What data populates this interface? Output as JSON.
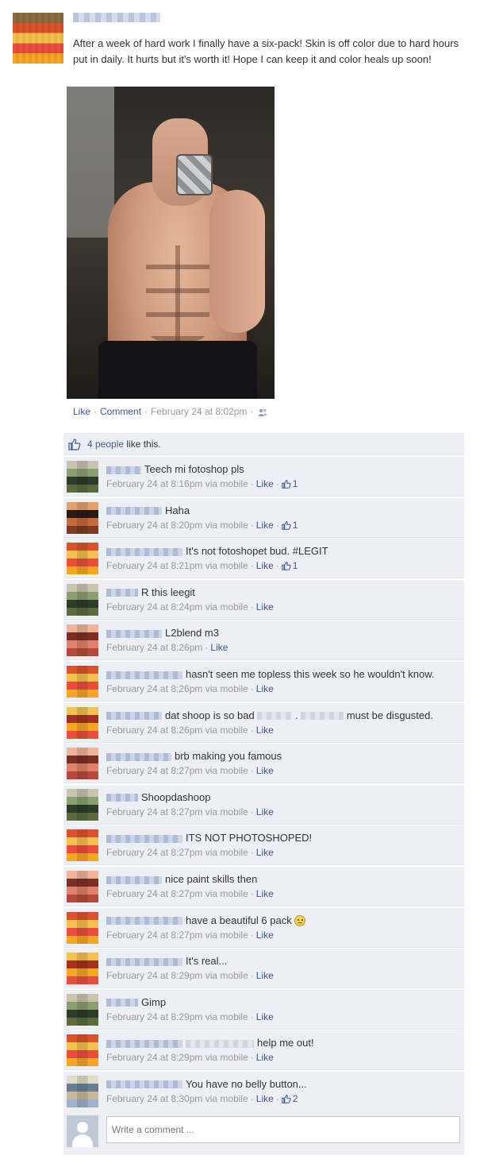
{
  "post": {
    "text": "After a week of hard work I finally have a six-pack! Skin is off color due to hard hours put in daily. It hurts but it's worth it! Hope I can keep it and color heals up soon!",
    "like_label": "Like",
    "comment_label": "Comment",
    "timestamp": "February 24 at 8:02pm",
    "privacy_icon": "friends-icon"
  },
  "likes": {
    "count_text": "4 people",
    "suffix": " like this."
  },
  "comments": [
    {
      "before": "Teech mi fotoshop pls",
      "after": "",
      "time": "February 24 at 8:16pm",
      "via": " via mobile",
      "like": "Like",
      "likes": "1",
      "name_w": 44,
      "pal": [
        "#5a6b3e",
        "#2e3a2a",
        "#8aa070",
        "#c9c3b0"
      ]
    },
    {
      "before": "Haha",
      "after": "",
      "time": "February 24 at 8:20pm",
      "via": " via mobile",
      "like": "Like",
      "likes": "1",
      "name_w": 70,
      "pal": [
        "#7a3b22",
        "#c46a3c",
        "#2a1a14",
        "#e0a070"
      ]
    },
    {
      "before": "It's not fotoshopet bud. #LEGIT",
      "after": "",
      "time": "February 24 at 8:21pm",
      "via": " via mobile",
      "like": "Like",
      "likes": "1",
      "name_w": 96,
      "pal": [
        "#f5a623",
        "#e94e3c",
        "#f2c14e",
        "#d9542b"
      ]
    },
    {
      "before": "R this leegit",
      "after": "",
      "time": "February 24 at 8:24pm",
      "via": " via mobile",
      "like": "Like",
      "likes": "",
      "name_w": 40,
      "pal": [
        "#5a6b3e",
        "#2e3a2a",
        "#8aa070",
        "#c9c3b0"
      ]
    },
    {
      "before": "L2blend m3",
      "after": "",
      "time": "February 24 at 8:26pm",
      "via": "",
      "like": "Like",
      "likes": "",
      "name_w": 70,
      "pal": [
        "#b54a3a",
        "#e0826a",
        "#7a2f24",
        "#f0b49a"
      ]
    },
    {
      "before": "hasn't seen me topless this week so he wouldn't know.",
      "after": "",
      "time": "February 24 at 8:26pm",
      "via": " via mobile",
      "like": "Like",
      "likes": "",
      "name_w": 96,
      "pal": [
        "#f5a623",
        "#e94e3c",
        "#f2c14e",
        "#d9542b"
      ]
    },
    {
      "before": "dat shoop is so bad",
      "after": "must be disgusted.",
      "blur1": 44,
      "blur2": 54,
      "time": "February 24 at 8:26pm",
      "via": " via mobile",
      "like": "Like",
      "likes": "",
      "name_w": 70,
      "pal": [
        "#e94e3c",
        "#f5a623",
        "#a3321f",
        "#f2c14e"
      ]
    },
    {
      "before": "brb making you famous",
      "after": "",
      "time": "February 24 at 8:27pm",
      "via": " via mobile",
      "like": "Like",
      "likes": "",
      "name_w": 82,
      "pal": [
        "#b54a3a",
        "#e0826a",
        "#7a2f24",
        "#f0b49a"
      ]
    },
    {
      "before": "Shoopdashoop",
      "after": "",
      "time": "February 24 at 8:27pm",
      "via": " via mobile",
      "like": "Like",
      "likes": "",
      "name_w": 40,
      "pal": [
        "#5a6b3e",
        "#2e3a2a",
        "#8aa070",
        "#c9c3b0"
      ]
    },
    {
      "before": "ITS NOT PHOTOSHOPED!",
      "after": "",
      "time": "February 24 at 8:27pm",
      "via": " via mobile",
      "like": "Like",
      "likes": "",
      "name_w": 96,
      "pal": [
        "#f5a623",
        "#e94e3c",
        "#f2c14e",
        "#d9542b"
      ]
    },
    {
      "before": "nice paint skills then",
      "after": "",
      "time": "February 24 at 8:27pm",
      "via": " via mobile",
      "like": "Like",
      "likes": "",
      "name_w": 70,
      "pal": [
        "#b54a3a",
        "#e0826a",
        "#7a2f24",
        "#f0b49a"
      ]
    },
    {
      "before": "have a beautiful 6 pack",
      "after": "",
      "sad": true,
      "time": "February 24 at 8:27pm",
      "via": " via mobile",
      "like": "Like",
      "likes": "",
      "name_w": 96,
      "pal": [
        "#f5a623",
        "#e94e3c",
        "#f2c14e",
        "#d9542b"
      ]
    },
    {
      "before": "It's real...",
      "after": "",
      "time": "February 24 at 8:29pm",
      "via": " via mobile",
      "like": "Like",
      "likes": "",
      "name_w": 96,
      "pal": [
        "#e94e3c",
        "#f5a623",
        "#a3321f",
        "#f2c14e"
      ]
    },
    {
      "before": "Gimp",
      "after": "",
      "time": "February 24 at 8:29pm",
      "via": " via mobile",
      "like": "Like",
      "likes": "",
      "name_w": 40,
      "pal": [
        "#5a6b3e",
        "#2e3a2a",
        "#8aa070",
        "#c9c3b0"
      ]
    },
    {
      "before": "help me out!",
      "after": "",
      "lead_blur": 86,
      "time": "February 24 at 8:29pm",
      "via": " via mobile",
      "like": "Like",
      "likes": "",
      "name_w": 96,
      "pal": [
        "#f5a623",
        "#e94e3c",
        "#f2c14e",
        "#d9542b"
      ]
    },
    {
      "before": "You have no belly button...",
      "after": "",
      "time": "February 24 at 8:30pm",
      "via": " via mobile",
      "like": "Like",
      "likes": "2",
      "name_w": 96,
      "pal": [
        "#9fb3c9",
        "#c9b79a",
        "#6a7f96",
        "#e3dccb"
      ]
    }
  ],
  "write_comment": {
    "placeholder": "Write a comment ..."
  }
}
